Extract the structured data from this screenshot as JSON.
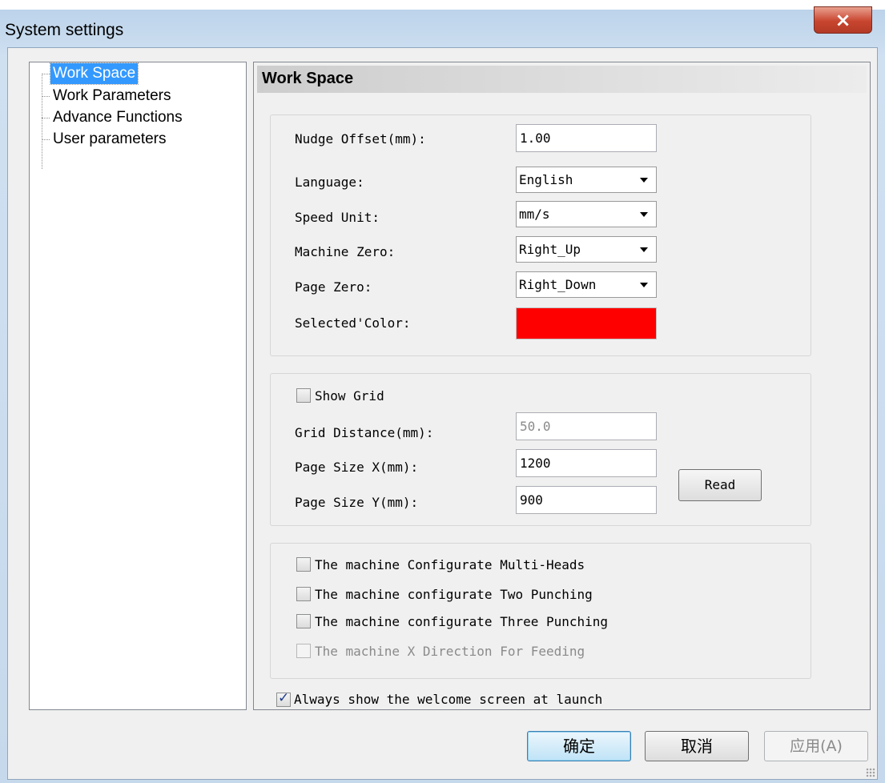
{
  "window": {
    "title": "System settings",
    "close_icon": "close-x-icon"
  },
  "tree": {
    "items": [
      {
        "label": "Work Space",
        "selected": true
      },
      {
        "label": "Work Parameters",
        "selected": false
      },
      {
        "label": "Advance Functions",
        "selected": false
      },
      {
        "label": "User parameters",
        "selected": false
      }
    ]
  },
  "panel": {
    "header": "Work Space",
    "general": {
      "nudge_offset": {
        "label": "Nudge Offset(mm):",
        "value": "1.00"
      },
      "language": {
        "label": "Language:",
        "value": "English"
      },
      "speed_unit": {
        "label": "Speed Unit:",
        "value": "mm/s"
      },
      "machine_zero": {
        "label": "Machine Zero:",
        "value": "Right_Up"
      },
      "page_zero": {
        "label": "Page Zero:",
        "value": "Right_Down"
      },
      "selected_color": {
        "label": "Selected'Color:",
        "color": "#ff0000"
      }
    },
    "grid": {
      "show_grid": {
        "label": "Show Grid",
        "checked": false
      },
      "grid_distance": {
        "label": "Grid Distance(mm):",
        "value": "50.0"
      },
      "page_size_x": {
        "label": "Page Size X(mm):",
        "value": "1200"
      },
      "page_size_y": {
        "label": "Page Size Y(mm):",
        "value": "900"
      },
      "read_button": "Read"
    },
    "machine": {
      "multi_heads": {
        "label": "The machine Configurate Multi-Heads",
        "checked": false
      },
      "two_punching": {
        "label": "The machine configurate Two Punching",
        "checked": false
      },
      "three_punching": {
        "label": "The machine configurate Three Punching",
        "checked": false
      },
      "x_feeding": {
        "label": "The machine X Direction For Feeding",
        "checked": false,
        "disabled": true
      }
    },
    "welcome": {
      "label": "Always show the welcome screen at launch",
      "checked": true
    }
  },
  "footer": {
    "ok": "确定",
    "cancel": "取消",
    "apply": "应用(A)"
  }
}
